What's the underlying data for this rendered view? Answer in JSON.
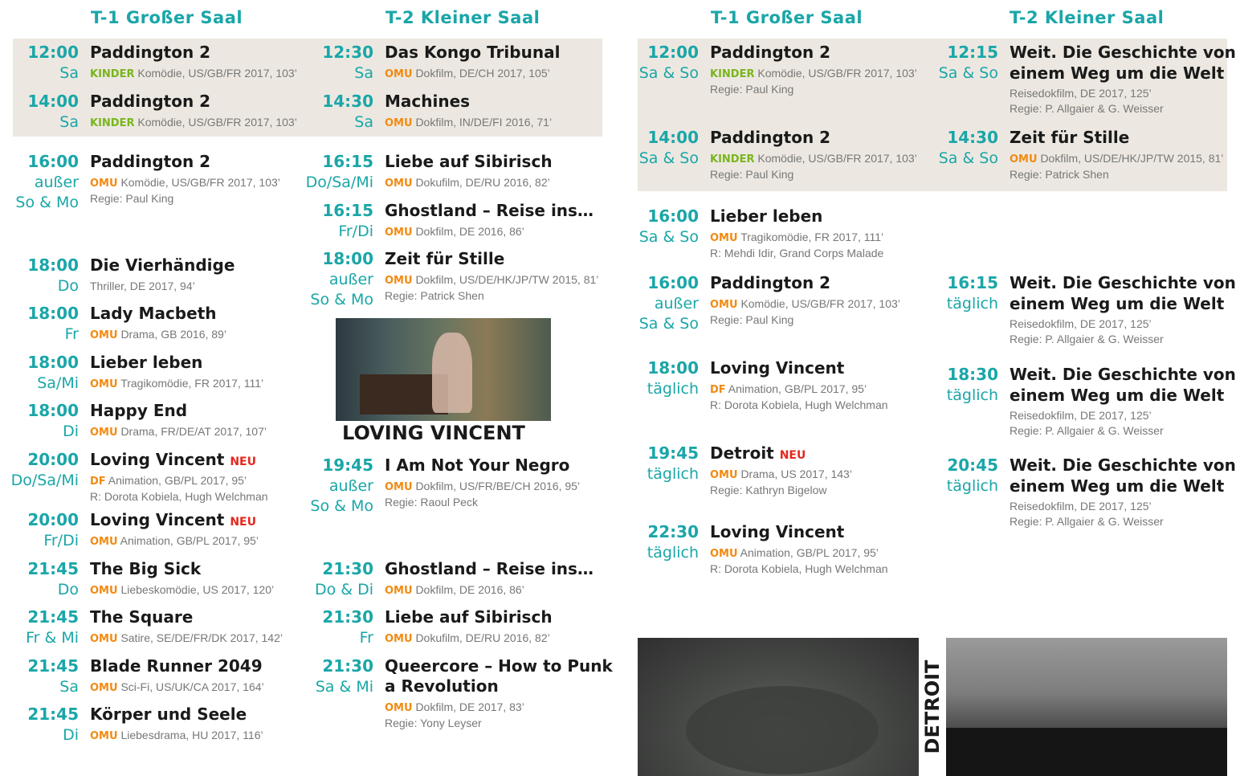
{
  "headers": {
    "left_t1": "T-1 Großer Saal",
    "left_t2": "T-2 Kleiner Saal",
    "right_t1": "T-1 Großer Saal",
    "right_t2": "T-2 Kleiner Saal"
  },
  "left_t1": [
    {
      "time": "12:00",
      "days": "Sa",
      "title": "Paddington 2",
      "tag": "KINDER",
      "info": "Komödie, US/GB/FR 2017, 103’"
    },
    {
      "time": "14:00",
      "days": "Sa",
      "title": "Paddington 2",
      "tag": "KINDER",
      "info": "Komödie, US/GB/FR 2017, 103’"
    },
    {
      "time": "16:00",
      "days": "außer",
      "days2": "So & Mo",
      "title": "Paddington 2",
      "tag": "OMU",
      "info": "Komödie, US/GB/FR 2017, 103’",
      "regie": "Regie: Paul King"
    },
    {
      "time": "18:00",
      "days": "Do",
      "title": "Die Vierhändige",
      "info": "Thriller, DE 2017, 94’"
    },
    {
      "time": "18:00",
      "days": "Fr",
      "title": "Lady Macbeth",
      "tag": "OMU",
      "info": "Drama, GB 2016, 89’"
    },
    {
      "time": "18:00",
      "days": "Sa/Mi",
      "title": "Lieber leben",
      "tag": "OMU",
      "info": "Tragikomödie, FR 2017, 111’"
    },
    {
      "time": "18:00",
      "days": "Di",
      "title": "Happy End",
      "tag": "OMU",
      "info": "Drama, FR/DE/AT 2017, 107’"
    },
    {
      "time": "20:00",
      "days": "Do/Sa/Mi",
      "title": "Loving Vincent",
      "neu": "NEU",
      "tag": "DF",
      "info": "Animation, GB/PL 2017, 95’",
      "regie": "R: Dorota Kobiela, Hugh Welchman"
    },
    {
      "time": "20:00",
      "days": "Fr/Di",
      "title": "Loving Vincent",
      "neu": "NEU",
      "tag": "OMU",
      "info": "Animation, GB/PL 2017, 95’"
    },
    {
      "time": "21:45",
      "days": "Do",
      "title": "The Big Sick",
      "tag": "OMU",
      "info": "Liebeskomödie, US 2017, 120’"
    },
    {
      "time": "21:45",
      "days": "Fr & Mi",
      "title": "The Square",
      "tag": "OMU",
      "info": "Satire, SE/DE/FR/DK 2017, 142’"
    },
    {
      "time": "21:45",
      "days": "Sa",
      "title": "Blade Runner 2049",
      "tag": "OMU",
      "info": "Sci-Fi, US/UK/CA 2017, 164’"
    },
    {
      "time": "21:45",
      "days": "Di",
      "title": "Körper und Seele",
      "tag": "OMU",
      "info": "Liebesdrama, HU 2017, 116’"
    }
  ],
  "left_t2": [
    {
      "time": "12:30",
      "days": "Sa",
      "title": "Das Kongo Tribunal",
      "tag": "OMU",
      "info": "Dokfilm, DE/CH 2017, 105’"
    },
    {
      "time": "14:30",
      "days": "Sa",
      "title": "Machines",
      "tag": "OMU",
      "info": "Dokfilm, IN/DE/FI 2016, 71’"
    },
    {
      "time": "16:15",
      "days": "Do/Sa/Mi",
      "title": "Liebe auf Sibirisch",
      "tag": "OMU",
      "info": "Dokufilm, DE/RU 2016, 82’"
    },
    {
      "time": "16:15",
      "days": "Fr/Di",
      "title": "Ghostland – Reise ins…",
      "tag": "OMU",
      "info": "Dokfilm, DE 2016, 86’"
    },
    {
      "time": "18:00",
      "days": "außer",
      "days2": "So & Mo",
      "title": "Zeit für Stille",
      "tag": "OMU",
      "info": "Dokfilm, US/DE/HK/JP/TW 2015, 81’",
      "regie": "Regie: Patrick Shen"
    },
    {
      "time": "19:45",
      "days": "außer",
      "days2": "So & Mo",
      "title": "I Am Not Your Negro",
      "tag": "OMU",
      "info": "Dokfilm, US/FR/BE/CH 2016, 95’",
      "regie": "Regie: Raoul Peck"
    },
    {
      "time": "21:30",
      "days": "Do & Di",
      "title": "Ghostland – Reise ins…",
      "tag": "OMU",
      "info": "Dokfilm, DE 2016, 86’"
    },
    {
      "time": "21:30",
      "days": "Fr",
      "title": "Liebe auf Sibirisch",
      "tag": "OMU",
      "info": "Dokufilm, DE/RU 2016, 82’"
    },
    {
      "time": "21:30",
      "days": "Sa & Mi",
      "title": "Queercore – How to Punk",
      "title2": "a Revolution",
      "tag": "OMU",
      "info": "Dokfilm, DE 2017, 83’",
      "regie": "Regie: Yony Leyser"
    }
  ],
  "right_t1": [
    {
      "time": "12:00",
      "days": "Sa & So",
      "title": "Paddington 2",
      "tag": "KINDER",
      "info": "Komödie, US/GB/FR 2017, 103’",
      "regie": "Regie: Paul King"
    },
    {
      "time": "14:00",
      "days": "Sa & So",
      "title": "Paddington 2",
      "tag": "KINDER",
      "info": "Komödie, US/GB/FR 2017, 103’",
      "regie": "Regie: Paul King"
    },
    {
      "time": "16:00",
      "days": "Sa & So",
      "title": "Lieber leben",
      "tag": "OMU",
      "info": "Tragikomödie, FR 2017, 111’",
      "regie": "R: Mehdi Idir, Grand Corps Malade"
    },
    {
      "time": "16:00",
      "days": "außer",
      "days2": "Sa & So",
      "title": "Paddington 2",
      "tag": "OMU",
      "info": "Komödie, US/GB/FR 2017, 103’",
      "regie": "Regie: Paul King"
    },
    {
      "time": "18:00",
      "days": "täglich",
      "title": "Loving Vincent",
      "tag": "DF",
      "info": "Animation, GB/PL 2017, 95’",
      "regie": "R: Dorota Kobiela, Hugh Welchman"
    },
    {
      "time": "19:45",
      "days": "täglich",
      "title": "Detroit",
      "neu": "NEU",
      "tag": "OMU",
      "info": "Drama, US 2017, 143’",
      "regie": "Regie: Kathryn Bigelow"
    },
    {
      "time": "22:30",
      "days": "täglich",
      "title": "Loving Vincent",
      "tag": "OMU",
      "info": "Animation, GB/PL 2017, 95’",
      "regie": "R: Dorota Kobiela, Hugh Welchman"
    }
  ],
  "right_t2": [
    {
      "time": "12:15",
      "days": "Sa & So",
      "title": "Weit. Die Geschichte von",
      "title2": "einem Weg um die Welt",
      "info": "Reisedokfilm, DE 2017, 125’",
      "regie": "Regie: P. Allgaier & G. Weisser"
    },
    {
      "time": "14:30",
      "days": "Sa & So",
      "title": "Zeit für Stille",
      "tag": "OMU",
      "info": "Dokfilm, US/DE/HK/JP/TW 2015, 81’",
      "regie": "Regie: Patrick Shen"
    },
    {
      "time": "16:15",
      "days": "täglich",
      "title": "Weit. Die Geschichte von",
      "title2": "einem Weg um die Welt",
      "info": "Reisedokfilm, DE 2017, 125’",
      "regie": "Regie: P. Allgaier & G. Weisser"
    },
    {
      "time": "18:30",
      "days": "täglich",
      "title": "Weit. Die Geschichte von",
      "title2": "einem Weg um die Welt",
      "info": "Reisedokfilm, DE 2017, 125’",
      "regie": "Regie: P. Allgaier & G. Weisser"
    },
    {
      "time": "20:45",
      "days": "täglich",
      "title": "Weit. Die Geschichte von",
      "title2": "einem Weg um die Welt",
      "info": "Reisedokfilm, DE 2017, 125’",
      "regie": "Regie: P. Allgaier & G. Weisser"
    }
  ],
  "images": {
    "loving_caption": "LOVING VINCENT",
    "detroit_caption": "DETROIT"
  }
}
